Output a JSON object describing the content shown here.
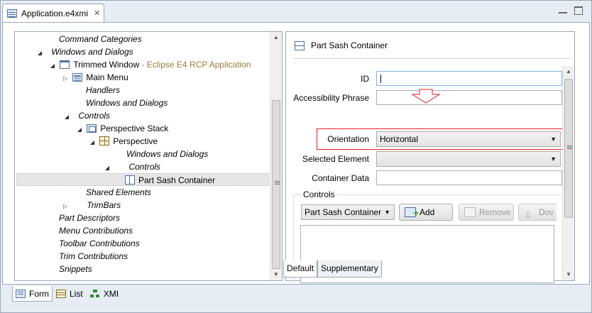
{
  "editor": {
    "tab_title": "Application.e4xmi",
    "close_glyph": "✕"
  },
  "tree": {
    "items": [
      {
        "label": "Command Categories",
        "suffix": ""
      },
      {
        "label": "Windows and Dialogs",
        "suffix": ""
      },
      {
        "label": "Trimmed Window",
        "suffix": " - Eclipse E4 RCP Application"
      },
      {
        "label": "Main Menu",
        "suffix": ""
      },
      {
        "label": "Handlers",
        "suffix": ""
      },
      {
        "label": "Windows and Dialogs",
        "suffix": ""
      },
      {
        "label": "Controls",
        "suffix": ""
      },
      {
        "label": "Perspective Stack",
        "suffix": ""
      },
      {
        "label": "Perspective",
        "suffix": ""
      },
      {
        "label": "Windows and Dialogs",
        "suffix": ""
      },
      {
        "label": "Controls",
        "suffix": ""
      },
      {
        "label": "Part Sash Container",
        "suffix": ""
      },
      {
        "label": "Shared Elements",
        "suffix": ""
      },
      {
        "label": "TrimBars",
        "suffix": ""
      },
      {
        "label": "Part Descriptors",
        "suffix": ""
      },
      {
        "label": "Menu Contributions",
        "suffix": ""
      },
      {
        "label": "Toolbar Contributions",
        "suffix": ""
      },
      {
        "label": "Trim Contributions",
        "suffix": ""
      },
      {
        "label": "Snippets",
        "suffix": ""
      }
    ],
    "selected": "Part Sash Container"
  },
  "form": {
    "title": "Part Sash Container",
    "id_label": "ID",
    "id_value": "",
    "accessibility_label": "Accessibility Phrase",
    "accessibility_value": "",
    "orientation_label": "Orientation",
    "orientation_value": "Horizontal",
    "selected_element_label": "Selected Element",
    "selected_element_value": "",
    "container_data_label": "Container Data",
    "container_data_value": "",
    "controls_group_label": "Controls",
    "controls_type_value": "Part Sash Container",
    "add_label": "Add",
    "remove_label": "Remove",
    "down_label": "Dov",
    "highlight_color": "#e02020"
  },
  "form_tabs": {
    "default_label": "Default",
    "supplementary_label": "Supplementary"
  },
  "view_tabs": {
    "form_label": "Form",
    "list_label": "List",
    "xmi_label": "XMI"
  }
}
